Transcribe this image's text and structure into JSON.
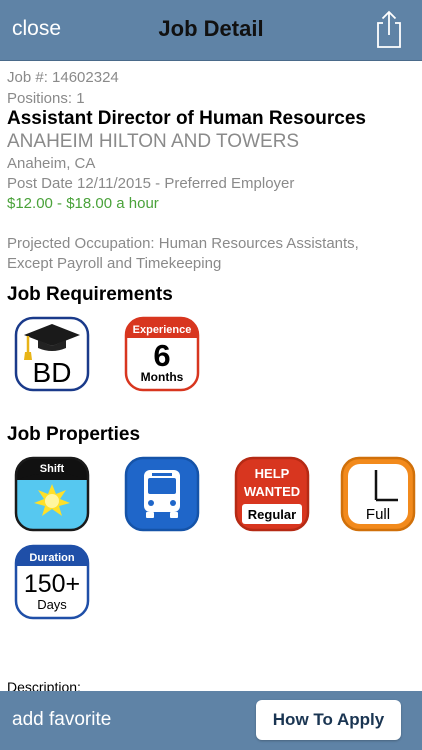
{
  "nav": {
    "close_label": "close",
    "title": "Job Detail",
    "share_icon": "share-icon"
  },
  "job": {
    "number": "Job #: 14602324",
    "positions": "Positions: 1",
    "title": "Assistant Director of Human Resources",
    "employer": "ANAHEIM HILTON AND TOWERS",
    "location": "Anaheim, CA",
    "post_date": "Post Date 12/11/2015 - Preferred Employer",
    "wage": "$12.00 - $18.00 a hour",
    "occupation_line1": "Projected Occupation: Human Resources Assistants,",
    "occupation_line2": "Except Payroll and Timekeeping",
    "description_label": "Description:"
  },
  "requirements": {
    "heading": "Job Requirements",
    "degree": {
      "text": "BD",
      "icon": "graduation-cap-icon"
    },
    "experience": {
      "header": "Experience",
      "number": "6",
      "unit": "Months"
    }
  },
  "properties": {
    "heading": "Job Properties",
    "shift": {
      "header": "Shift",
      "icon": "sun-icon"
    },
    "transit": {
      "icon": "bus-icon"
    },
    "help": {
      "line1": "HELP",
      "line2": "WANTED",
      "line3": "Regular"
    },
    "time": {
      "text": "Full",
      "icon": "clock-icon"
    },
    "duration": {
      "header": "Duration",
      "number": "150+",
      "unit": "Days"
    }
  },
  "bottom": {
    "favorite_label": "add favorite",
    "apply_label": "How To Apply"
  },
  "colors": {
    "bar": "#5f83a6",
    "wage": "#4aa23a",
    "navy": "#1a3a8a",
    "red": "#d8361f",
    "blue": "#1f66c9",
    "orange": "#f28a1c",
    "sky": "#56c8f0",
    "yellow": "#ffe028"
  }
}
